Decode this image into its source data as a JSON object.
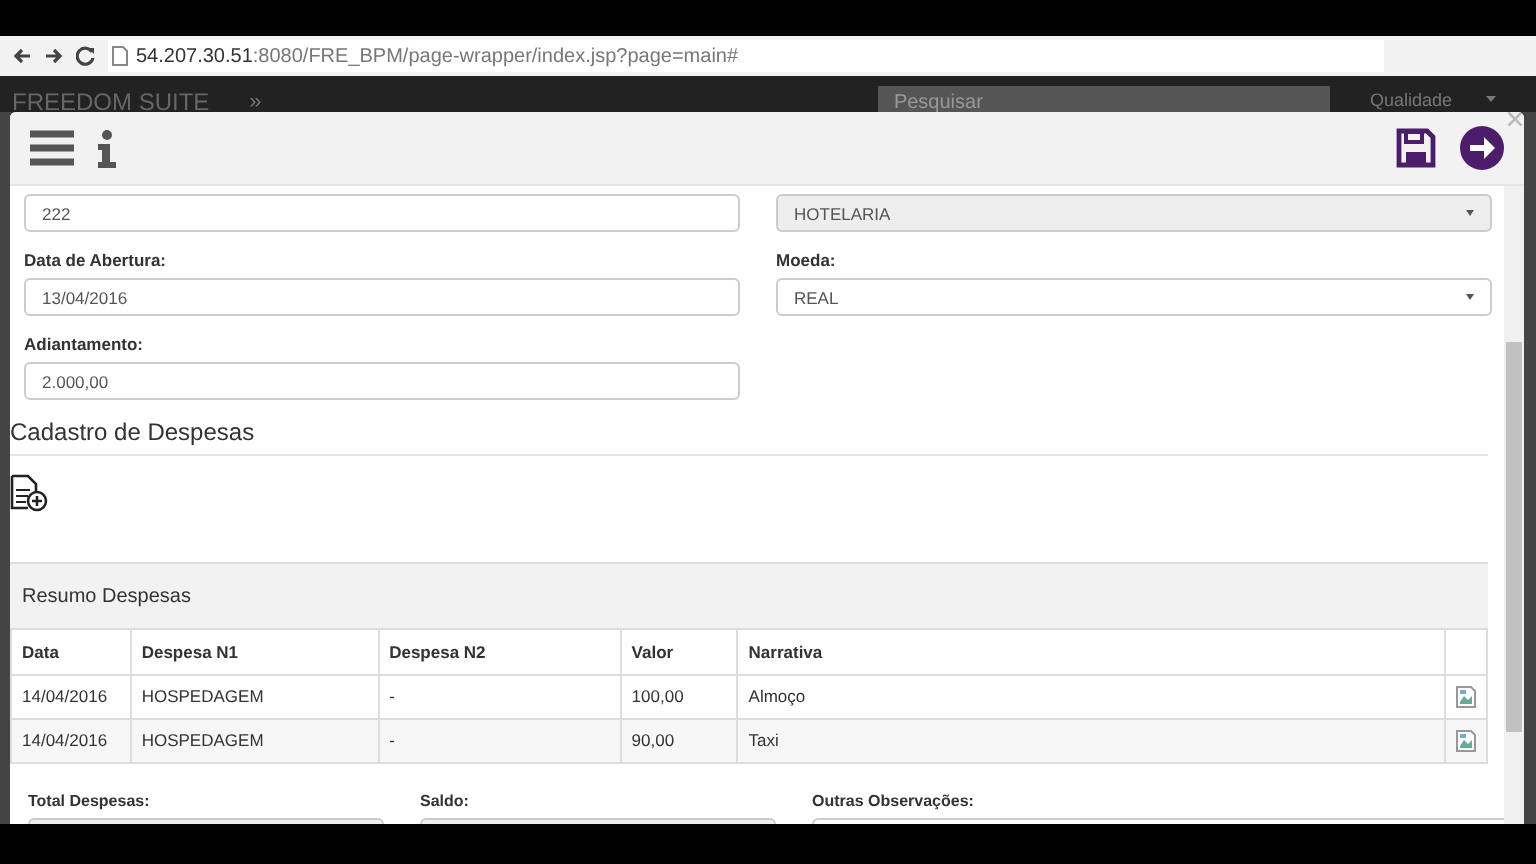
{
  "browser": {
    "url_host": "54.207.30.51",
    "url_rest": ":8080/FRE_BPM/page-wrapper/index.jsp?page=main#"
  },
  "navbar": {
    "brand": "FREEDOM SUITE",
    "toggle": "»",
    "search": {
      "placeholder": "Pesquisar"
    },
    "user": "Qualidade"
  },
  "form": {
    "fields": [
      {
        "kind": "input",
        "value": "222"
      },
      {
        "kind": "select",
        "value": "HOTELARIA",
        "disabled": true
      },
      {
        "kind": "input",
        "label": "Data de Abertura:",
        "value": "13/04/2016"
      },
      {
        "kind": "select",
        "label": "Moeda:",
        "value": "REAL",
        "disabled": false
      },
      {
        "kind": "input",
        "label": "Adiantamento:",
        "value": "2.000,00"
      }
    ]
  },
  "section_title": "Cadastro de Despesas",
  "table": {
    "title": "Resumo Despesas",
    "columns": [
      "Data",
      "Despesa N1",
      "Despesa N2",
      "Valor",
      "Narrativa"
    ],
    "rows": [
      {
        "cells": [
          "14/04/2016",
          "HOSPEDAGEM",
          "-",
          "100,00",
          "Almoço"
        ]
      },
      {
        "cells": [
          "14/04/2016",
          "HOSPEDAGEM",
          "-",
          "90,00",
          "Taxi"
        ]
      }
    ]
  },
  "footer_labels": [
    "Total Despesas:",
    "Saldo:",
    "Outras Observações:"
  ]
}
